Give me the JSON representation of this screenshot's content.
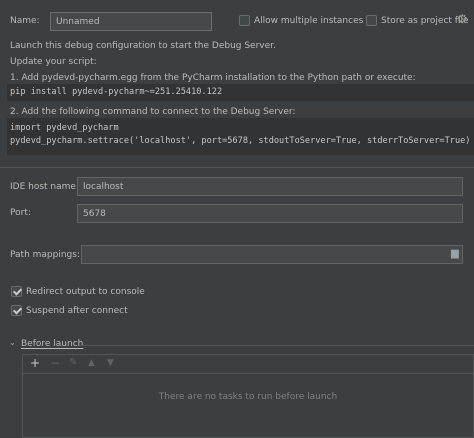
{
  "name_label": "Name:",
  "name_value": "Unnamed",
  "allow_multiple": {
    "label": "Allow multiple instances",
    "checked": false
  },
  "store_project": {
    "label": "Store as project file",
    "checked": false
  },
  "intro_line1": "Launch this debug configuration to start the Debug Server.",
  "intro_line2": "Update your script:",
  "step1": "1. Add pydevd-pycharm.egg from the PyCharm installation to the Python path or execute:",
  "step1_code": "pip install pydevd-pycharm~=251.25410.122",
  "step2": "2. Add the following command to connect to the Debug Server:",
  "step2_code_line1": "import pydevd_pycharm",
  "step2_code_line2": "pydevd_pycharm.settrace('localhost', port=5678, stdoutToServer=True, stderrToServer=True)",
  "ide_host": {
    "label": "IDE host name:",
    "value": "localhost"
  },
  "port": {
    "label": "Port:",
    "value": "5678"
  },
  "path_mappings": {
    "label": "Path mappings:",
    "value": ""
  },
  "redirect_output": {
    "label": "Redirect output to console",
    "checked": true
  },
  "suspend_after": {
    "label": "Suspend after connect",
    "checked": true
  },
  "before_launch": {
    "label": "Before launch",
    "empty_text": "There are no tasks to run before launch",
    "toolbar": [
      "+",
      "−",
      "✎",
      "▲",
      "▼"
    ]
  },
  "colors": {
    "background": "#3c3f41",
    "input_bg": "#45494a",
    "code_bg": "#313335",
    "text": "#bbbbbb"
  },
  "icons": [
    "gear-icon",
    "folder-icon",
    "chevron-down-icon",
    "add-icon",
    "remove-icon",
    "edit-icon",
    "move-up-icon",
    "move-down-icon"
  ]
}
